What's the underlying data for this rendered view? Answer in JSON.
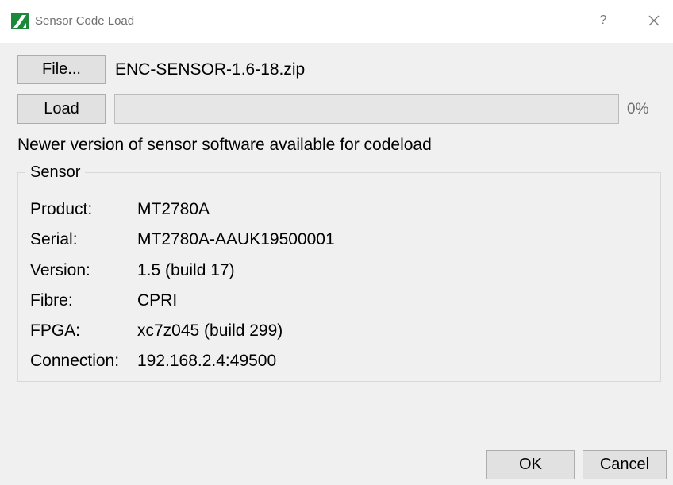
{
  "window": {
    "title": "Sensor Code Load",
    "help_label": "?",
    "close_icon": "close-icon",
    "app_icon": "app-logo-icon"
  },
  "file": {
    "button_label": "File...",
    "selected_file": "ENC-SENSOR-1.6-18.zip"
  },
  "load": {
    "button_label": "Load",
    "progress_percent": 0,
    "progress_text": "0%"
  },
  "status_message": "Newer version of sensor software available for codeload",
  "sensor": {
    "group_title": "Sensor",
    "rows": [
      {
        "label": "Product:",
        "value": "MT2780A"
      },
      {
        "label": "Serial:",
        "value": "MT2780A-AAUK19500001"
      },
      {
        "label": "Version:",
        "value": "1.5 (build 17)"
      },
      {
        "label": "Fibre:",
        "value": "CPRI"
      },
      {
        "label": "FPGA:",
        "value": "xc7z045 (build 299)"
      },
      {
        "label": "Connection:",
        "value": "192.168.2.4:49500"
      }
    ]
  },
  "footer": {
    "ok_label": "OK",
    "cancel_label": "Cancel"
  },
  "colors": {
    "dialog_background": "#f0f0f0",
    "titlebar_background": "#ffffff",
    "button_background": "#e1e1e1",
    "logo_green": "#1a8a3a"
  }
}
